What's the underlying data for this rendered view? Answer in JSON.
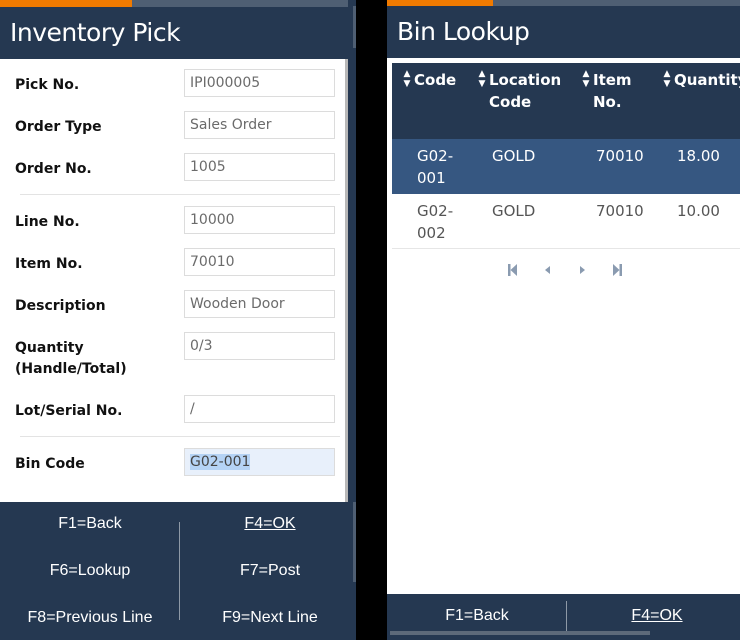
{
  "colors": {
    "header_bg": "#253851",
    "accent": "#f07a00",
    "selected_row": "#365781",
    "selection_highlight": "#b5d3f5"
  },
  "left": {
    "title": "Inventory Pick",
    "progress": 0.37,
    "fields": [
      {
        "label": "Pick No.",
        "value": "IPI000005"
      },
      {
        "label": "Order Type",
        "value": "Sales Order"
      },
      {
        "label": "Order No.",
        "value": "1005"
      },
      {
        "label": "Line No.",
        "value": "10000"
      },
      {
        "label": "Item No.",
        "value": "70010"
      },
      {
        "label": "Description",
        "value": "Wooden Door"
      },
      {
        "label": "Quantity (Handle/Total)",
        "value": "0/3"
      },
      {
        "label": "Lot/Serial No.",
        "value": "/"
      },
      {
        "label": "Bin Code",
        "value": "G02-001"
      }
    ],
    "function_keys": [
      {
        "label": "F1=Back"
      },
      {
        "label": "F4=OK"
      },
      {
        "label": "F6=Lookup"
      },
      {
        "label": "F7=Post"
      },
      {
        "label": "F8=Previous Line"
      },
      {
        "label": "F9=Next Line"
      }
    ]
  },
  "right": {
    "title": "Bin Lookup",
    "progress": 0.3,
    "columns": [
      {
        "label": "Code",
        "sort_icon": "sort-icon"
      },
      {
        "label": "Location Code",
        "sort_icon": "sort-icon"
      },
      {
        "label": "Item No.",
        "sort_icon": "sort-icon"
      },
      {
        "label": "Quantity",
        "sort_icon": "sort-icon"
      }
    ],
    "rows": [
      {
        "code": "G02-001",
        "location": "GOLD",
        "item": "70010",
        "quantity": "18.00",
        "selected": true
      },
      {
        "code": "G02-002",
        "location": "GOLD",
        "item": "70010",
        "quantity": "10.00",
        "selected": false
      }
    ],
    "pager": [
      "first-page-icon",
      "previous-page-icon",
      "next-page-icon",
      "last-page-icon"
    ],
    "function_keys": [
      {
        "label": "F1=Back"
      },
      {
        "label": "F4=OK"
      }
    ]
  }
}
